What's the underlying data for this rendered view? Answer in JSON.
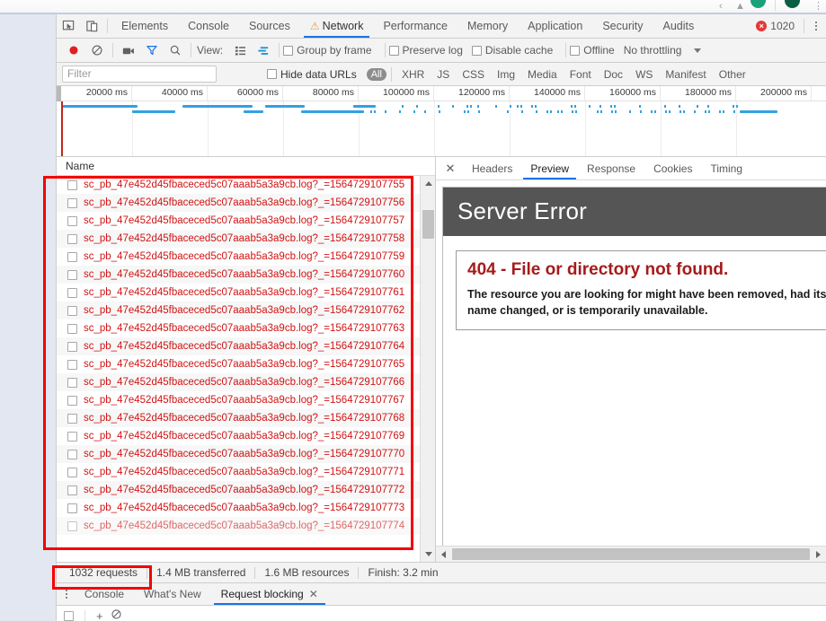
{
  "browser": {
    "icons": [
      "back-arrow",
      "forward-arrow",
      "profile-avatar",
      "extension-avatar"
    ]
  },
  "devtools": {
    "main_tabs": [
      {
        "label": "Elements",
        "active": false,
        "warn": false
      },
      {
        "label": "Console",
        "active": false,
        "warn": false
      },
      {
        "label": "Sources",
        "active": false,
        "warn": false
      },
      {
        "label": "Network",
        "active": true,
        "warn": true
      },
      {
        "label": "Performance",
        "active": false,
        "warn": false
      },
      {
        "label": "Memory",
        "active": false,
        "warn": false
      },
      {
        "label": "Application",
        "active": false,
        "warn": false
      },
      {
        "label": "Security",
        "active": false,
        "warn": false
      },
      {
        "label": "Audits",
        "active": false,
        "warn": false
      }
    ],
    "inspect_icon": "inspect-element-icon",
    "device_icon": "device-toolbar-icon",
    "error_badge": {
      "count": "1020",
      "glyph": "×"
    },
    "more_menu_icon": "kebab-menu-icon",
    "accent_color": "#1a73e8",
    "warn_color": "#e8a33d",
    "error_color": "#e53935"
  },
  "network_toolbar": {
    "record_icon": "record-stop-icon",
    "clear_icon": "clear-icon",
    "capture_screenshots_icon": "camera-icon",
    "filter_icon": "filter-funnel-icon",
    "search_icon": "search-icon",
    "view_label": "View:",
    "view_list_icon": "list-view-icon",
    "view_waterfall_icon": "waterfall-view-icon",
    "group_by_frame": "Group by frame",
    "preserve_log": "Preserve log",
    "disable_cache": "Disable cache",
    "offline": "Offline",
    "throttling": "No throttling",
    "throttle_caret": "chevron-down-icon"
  },
  "filter_bar": {
    "placeholder": "Filter",
    "value": "",
    "hide_data_urls": "Hide data URLs",
    "types": [
      {
        "label": "All",
        "selected": true
      },
      {
        "label": "XHR",
        "selected": false
      },
      {
        "label": "JS",
        "selected": false
      },
      {
        "label": "CSS",
        "selected": false
      },
      {
        "label": "Img",
        "selected": false
      },
      {
        "label": "Media",
        "selected": false
      },
      {
        "label": "Font",
        "selected": false
      },
      {
        "label": "Doc",
        "selected": false
      },
      {
        "label": "WS",
        "selected": false
      },
      {
        "label": "Manifest",
        "selected": false
      },
      {
        "label": "Other",
        "selected": false
      }
    ]
  },
  "overview": {
    "tick_labels": [
      "20000 ms",
      "40000 ms",
      "60000 ms",
      "80000 ms",
      "100000 ms",
      "120000 ms",
      "140000 ms",
      "160000 ms",
      "180000 ms",
      "200000 ms"
    ],
    "bar_color": "#33a1e0",
    "marker_color": "#c0271a"
  },
  "request_list": {
    "column_header": "Name",
    "rows": [
      {
        "name": "sc_pb_47e452d45fbaceced5c07aaab5a3a9cb.log?_=1564729107755"
      },
      {
        "name": "sc_pb_47e452d45fbaceced5c07aaab5a3a9cb.log?_=1564729107756"
      },
      {
        "name": "sc_pb_47e452d45fbaceced5c07aaab5a3a9cb.log?_=1564729107757"
      },
      {
        "name": "sc_pb_47e452d45fbaceced5c07aaab5a3a9cb.log?_=1564729107758"
      },
      {
        "name": "sc_pb_47e452d45fbaceced5c07aaab5a3a9cb.log?_=1564729107759"
      },
      {
        "name": "sc_pb_47e452d45fbaceced5c07aaab5a3a9cb.log?_=1564729107760"
      },
      {
        "name": "sc_pb_47e452d45fbaceced5c07aaab5a3a9cb.log?_=1564729107761"
      },
      {
        "name": "sc_pb_47e452d45fbaceced5c07aaab5a3a9cb.log?_=1564729107762"
      },
      {
        "name": "sc_pb_47e452d45fbaceced5c07aaab5a3a9cb.log?_=1564729107763"
      },
      {
        "name": "sc_pb_47e452d45fbaceced5c07aaab5a3a9cb.log?_=1564729107764"
      },
      {
        "name": "sc_pb_47e452d45fbaceced5c07aaab5a3a9cb.log?_=1564729107765"
      },
      {
        "name": "sc_pb_47e452d45fbaceced5c07aaab5a3a9cb.log?_=1564729107766"
      },
      {
        "name": "sc_pb_47e452d45fbaceced5c07aaab5a3a9cb.log?_=1564729107767"
      },
      {
        "name": "sc_pb_47e452d45fbaceced5c07aaab5a3a9cb.log?_=1564729107768"
      },
      {
        "name": "sc_pb_47e452d45fbaceced5c07aaab5a3a9cb.log?_=1564729107769"
      },
      {
        "name": "sc_pb_47e452d45fbaceced5c07aaab5a3a9cb.log?_=1564729107770"
      },
      {
        "name": "sc_pb_47e452d45fbaceced5c07aaab5a3a9cb.log?_=1564729107771"
      },
      {
        "name": "sc_pb_47e452d45fbaceced5c07aaab5a3a9cb.log?_=1564729107772"
      },
      {
        "name": "sc_pb_47e452d45fbaceced5c07aaab5a3a9cb.log?_=1564729107773"
      },
      {
        "name": "sc_pb_47e452d45fbaceced5c07aaab5a3a9cb.log?_=1564729107774"
      }
    ],
    "row_text_color": "#d01414"
  },
  "details": {
    "close_icon": "close-icon",
    "tabs": [
      {
        "label": "Headers",
        "active": false
      },
      {
        "label": "Preview",
        "active": true
      },
      {
        "label": "Response",
        "active": false
      },
      {
        "label": "Cookies",
        "active": false
      },
      {
        "label": "Timing",
        "active": false
      }
    ],
    "preview": {
      "header": "Server Error",
      "error_title": "404 - File or directory not found.",
      "error_body": "The resource you are looking for might have been removed, had its name changed, or is temporarily unavailable.",
      "header_bg": "#555555",
      "title_color": "#a51b1b"
    }
  },
  "summary": {
    "requests": "1032 requests",
    "transferred": "1.4 MB transferred",
    "resources": "1.6 MB resources",
    "finish": "Finish: 3.2 min"
  },
  "drawer": {
    "menu_icon": "kebab-menu-icon",
    "tabs": [
      {
        "label": "Console",
        "active": false,
        "closable": false
      },
      {
        "label": "What's New",
        "active": false,
        "closable": false
      },
      {
        "label": "Request blocking",
        "active": true,
        "closable": true
      }
    ],
    "close_glyph": "✕"
  },
  "annotations": [
    {
      "name": "request-list-highlight",
      "color": "#f50000"
    },
    {
      "name": "requests-count-highlight",
      "color": "#f50000"
    }
  ]
}
